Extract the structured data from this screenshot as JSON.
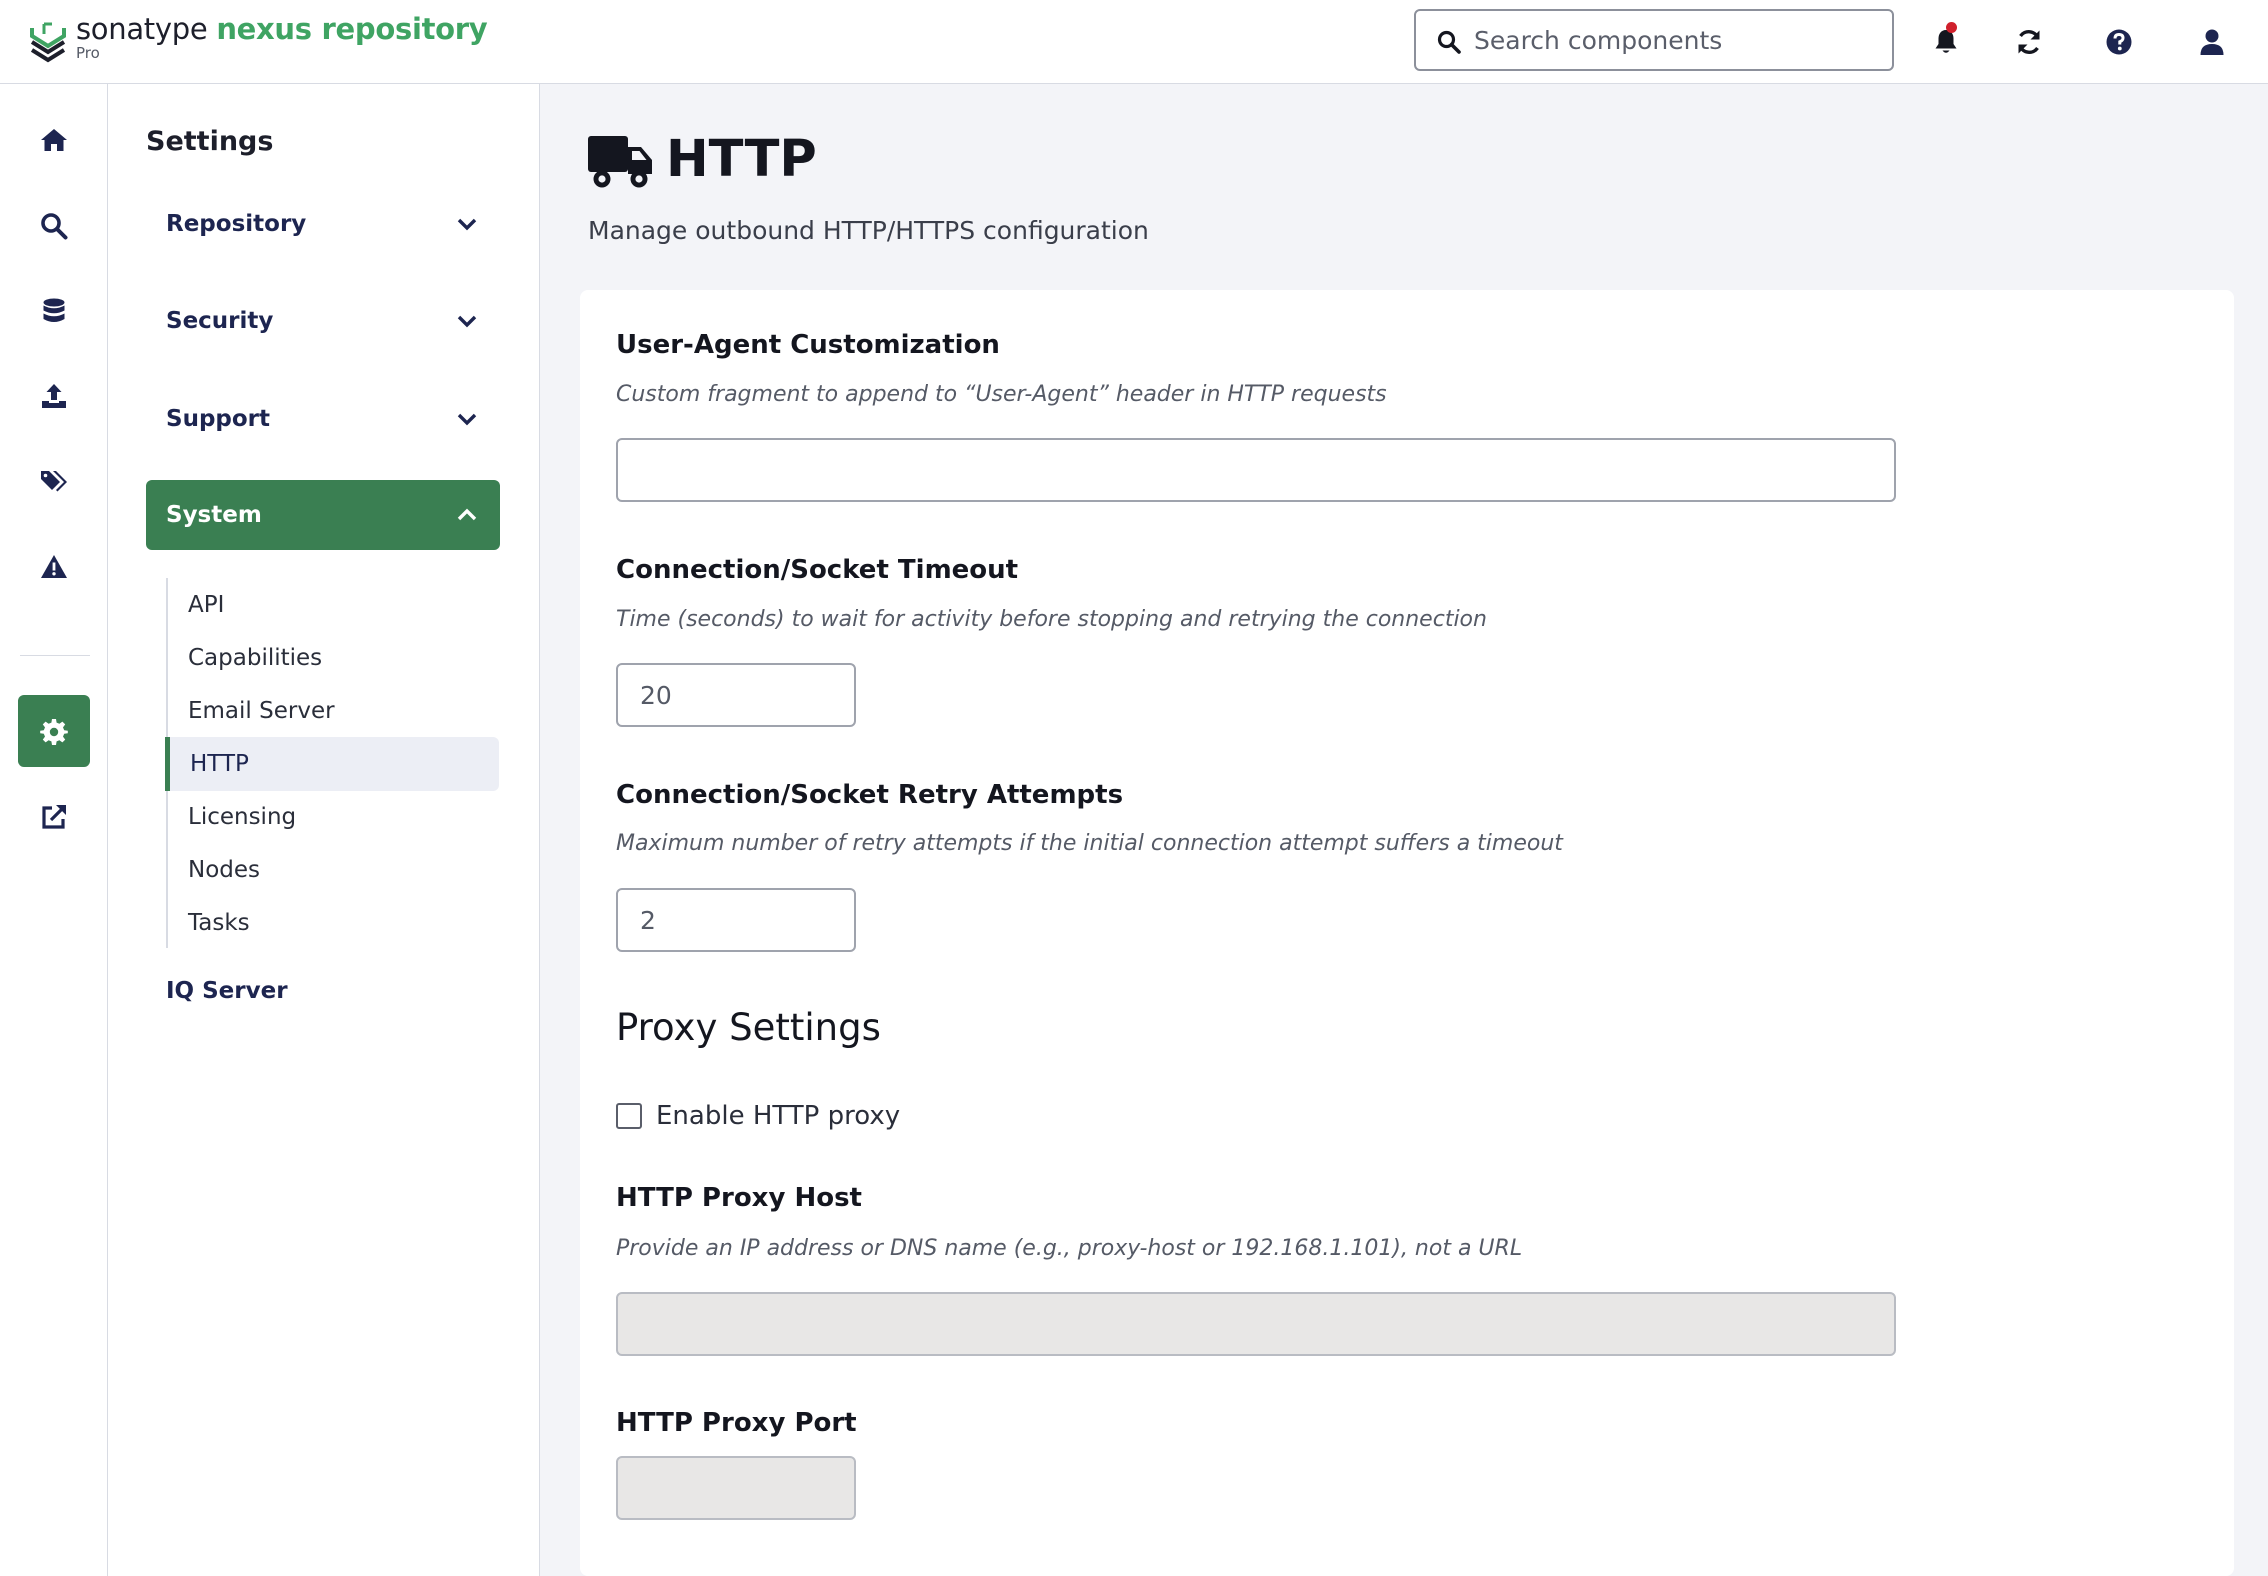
{
  "header": {
    "brand": "sonatype",
    "product": "nexus repository",
    "edition": "Pro",
    "search": {
      "placeholder": "Search components",
      "value": ""
    },
    "icons": {
      "search": "search-icon",
      "notifications": "bell-icon",
      "refresh": "refresh-icon",
      "help": "help-icon",
      "user": "user-icon"
    },
    "notification_dot_color": "#d0202c"
  },
  "rail": {
    "items": [
      {
        "icon": "home-icon"
      },
      {
        "icon": "search-icon"
      },
      {
        "icon": "database-icon"
      },
      {
        "icon": "upload-icon"
      },
      {
        "icon": "tags-icon"
      },
      {
        "icon": "warning-icon"
      },
      {
        "icon": "gear-icon",
        "active": true
      },
      {
        "icon": "external-link-icon"
      }
    ]
  },
  "sidebar": {
    "title": "Settings",
    "groups": [
      {
        "label": "Repository",
        "expanded": false
      },
      {
        "label": "Security",
        "expanded": false
      },
      {
        "label": "Support",
        "expanded": false
      },
      {
        "label": "System",
        "expanded": true
      }
    ],
    "system_items": [
      {
        "label": "API"
      },
      {
        "label": "Capabilities"
      },
      {
        "label": "Email Server"
      },
      {
        "label": "HTTP",
        "active": true
      },
      {
        "label": "Licensing"
      },
      {
        "label": "Nodes"
      },
      {
        "label": "Tasks"
      }
    ],
    "iq_server": "IQ Server"
  },
  "page": {
    "title": "HTTP",
    "subtitle": "Manage outbound HTTP/HTTPS configuration",
    "icon": "truck-icon"
  },
  "form": {
    "user_agent": {
      "label": "User-Agent Customization",
      "help": "Custom fragment to append to “User-Agent” header in HTTP requests",
      "value": ""
    },
    "timeout": {
      "label": "Connection/Socket Timeout",
      "help": "Time (seconds) to wait for activity before stopping and retrying the connection",
      "value": "20"
    },
    "retries": {
      "label": "Connection/Socket Retry Attempts",
      "help": "Maximum number of retry attempts if the initial connection attempt suffers a timeout",
      "value": "2"
    },
    "proxy_section_title": "Proxy Settings",
    "enable_proxy": {
      "label": "Enable HTTP proxy",
      "checked": false
    },
    "proxy_host": {
      "label": "HTTP Proxy Host",
      "help": "Provide an IP address or DNS name (e.g., proxy-host or 192.168.1.101), not a URL",
      "value": "",
      "disabled": true
    },
    "proxy_port": {
      "label": "HTTP Proxy Port",
      "value": "",
      "disabled": true
    }
  },
  "colors": {
    "accent": "#3a7f52",
    "brand_green": "#3fa463",
    "navy": "#1d2550",
    "page_bg": "#f3f4f8"
  }
}
